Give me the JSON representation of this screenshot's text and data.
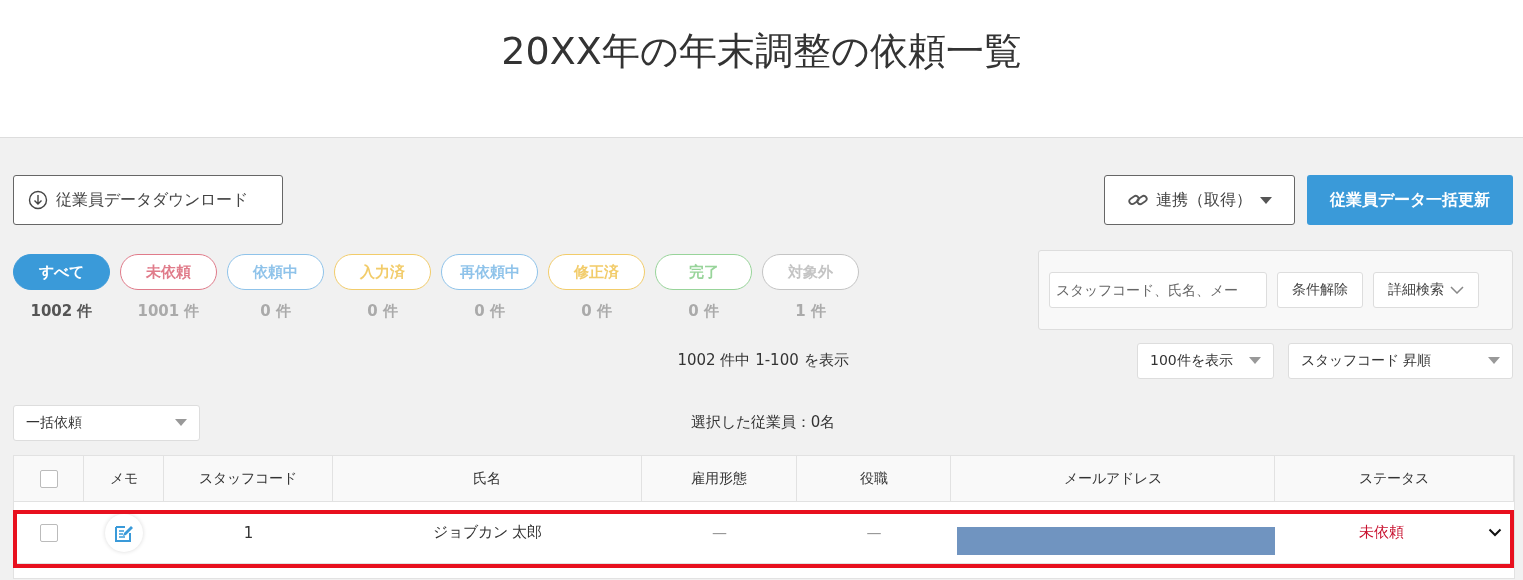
{
  "title": "20XX年の年末調整の依頼一覧",
  "download_button": "従業員データダウンロード",
  "link_button": "連携（取得）",
  "bulk_update_button": "従業員データ一括更新",
  "status_filters": [
    {
      "label": "すべて",
      "count": "1002 件",
      "selected": true,
      "color": "#3a9ad9"
    },
    {
      "label": "未依頼",
      "count": "1001 件",
      "selected": false,
      "color": "#e07b8a"
    },
    {
      "label": "依頼中",
      "count": "0 件",
      "selected": false,
      "color": "#8fc3ea"
    },
    {
      "label": "入力済",
      "count": "0 件",
      "selected": false,
      "color": "#f2cc6a"
    },
    {
      "label": "再依頼中",
      "count": "0 件",
      "selected": false,
      "color": "#8fc3ea"
    },
    {
      "label": "修正済",
      "count": "0 件",
      "selected": false,
      "color": "#f2cc6a"
    },
    {
      "label": "完了",
      "count": "0 件",
      "selected": false,
      "color": "#98d49a"
    },
    {
      "label": "対象外",
      "count": "1 件",
      "selected": false,
      "color": "#c4c4c4"
    }
  ],
  "search": {
    "placeholder": "スタッフコード、氏名、メー"
  },
  "clear_button": "条件解除",
  "advanced_search_button": "詳細検索",
  "result_summary": "1002 件中 1-100 を表示",
  "per_page_select": "100件を表示",
  "sort_select": "スタッフコード 昇順",
  "bulk_action_select": "一括依頼",
  "selected_count": "選択した従業員：0名",
  "table": {
    "header_checked": false,
    "columns": [
      "メモ",
      "スタッフコード",
      "氏名",
      "雇用形態",
      "役職",
      "メールアドレス",
      "ステータス"
    ],
    "rows": [
      {
        "checked": false,
        "highlighted": true,
        "email_redacted": true,
        "code": "1",
        "name": "ジョブカン 太郎",
        "employment_type": "—",
        "position": "—",
        "status": "未依頼"
      }
    ]
  }
}
